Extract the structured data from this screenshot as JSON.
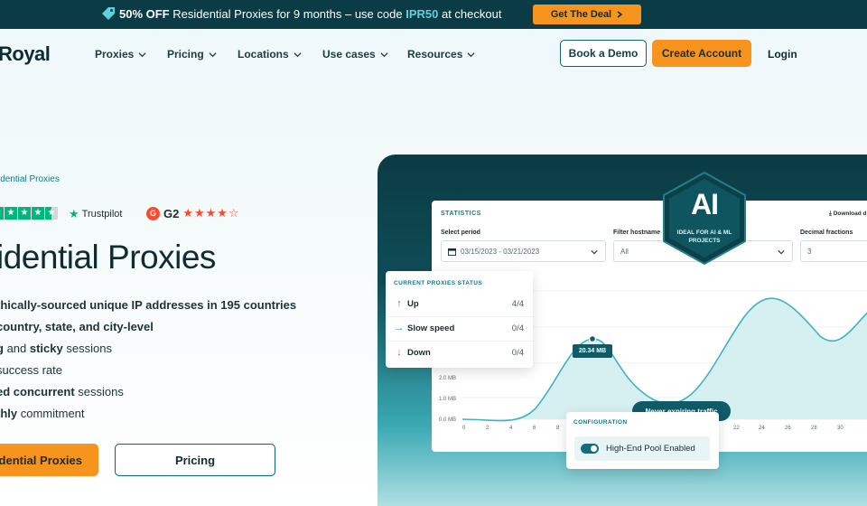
{
  "promo": {
    "icon": "tag-icon",
    "lead": "50% OFF",
    "text": " Residential Proxies for 9 months – use code ",
    "code": "IPR50",
    "tail": " at checkout",
    "cta": "Get The Deal"
  },
  "nav": {
    "logo": "Royal",
    "items": [
      "Proxies",
      "Pricing",
      "Locations",
      "Use cases",
      "Resources"
    ],
    "book_demo": "Book a Demo",
    "create_account": "Create Account",
    "login": "Login"
  },
  "hero": {
    "breadcrumb": "idential Proxies",
    "trustpilot": "Trustpilot",
    "trustpilot_rating": 4.5,
    "g2": "G2",
    "g2_rating": 4.5,
    "title": "idential Proxies",
    "features": [
      {
        "bold": "",
        "text": "thically-sourced unique IP addresses in 195 countries",
        "all_bold": true
      },
      {
        "bold": "",
        "text": "country, state, and city-level",
        "all_bold": true
      },
      {
        "bold": "g",
        "text": " and ",
        "bold2": "sticky",
        "text2": " sessions"
      },
      {
        "bold": "",
        "text": "success rate",
        "all_bold": false
      },
      {
        "bold": "ed concurrent",
        "text": " sessions"
      },
      {
        "bold": "thly",
        "text": " commitment"
      }
    ],
    "cta_primary": "idential Proxies",
    "cta_secondary": "Pricing"
  },
  "dashboard": {
    "section_title": "STATISTICS",
    "download": "Download d",
    "select_period_label": "Select period",
    "period_value": "03/15/2023 - 03/21/2023",
    "filter_label": "Filter hostname",
    "filter_value": "All",
    "decimal_label": "Decimal fractions",
    "decimal_value": "3",
    "ai_badge": {
      "big": "AI",
      "sub": "IDEAL FOR AI & ML PROJECTS"
    },
    "status": {
      "title": "CURRENT PROXIES STATUS",
      "rows": [
        {
          "label": "Up",
          "value": "4/4",
          "icon": "arrow-up-icon",
          "color": "#1aa36b"
        },
        {
          "label": "Slow speed",
          "value": "0/4",
          "icon": "arrow-right-icon",
          "color": "#2a86c9"
        },
        {
          "label": "Down",
          "value": "0/4",
          "icon": "arrow-down-icon",
          "color": "#e0533d"
        }
      ]
    },
    "tooltip": "20.34 MB",
    "traffic_pill": "Never expiring traffic",
    "config": {
      "title": "CONFIGURATION",
      "toggle_label": "High-End Pool Enabled",
      "enabled": true
    }
  },
  "chart_data": {
    "type": "line",
    "y_ticks": [
      "2.0 MB",
      "1.0 MB",
      "0.0 MB"
    ],
    "x_ticks": [
      "0",
      "2",
      "4",
      "6",
      "8",
      "22",
      "24",
      "26",
      "28",
      "30"
    ],
    "colors": {
      "line": "#3fb3bf",
      "fill": "#d6f0f2"
    }
  },
  "colors": {
    "accent": "#f7941d",
    "brand": "#0b3b44",
    "teal": "#0f7b88"
  }
}
